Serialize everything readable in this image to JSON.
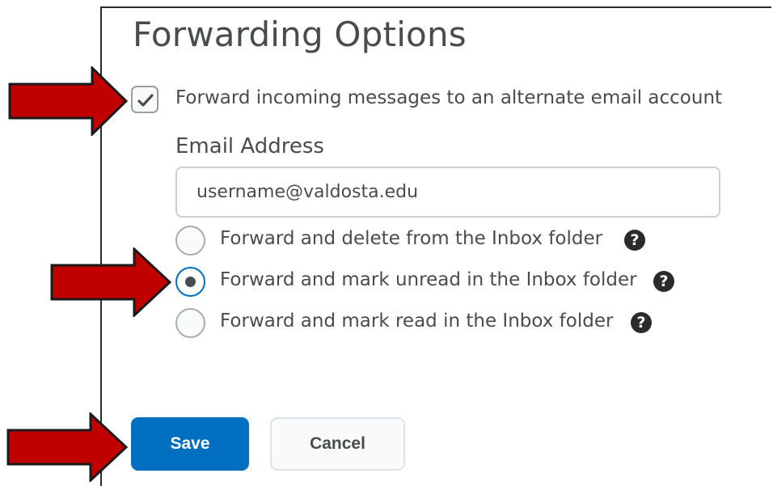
{
  "page": {
    "title": "Forwarding Options"
  },
  "forward_checkbox": {
    "checked": true,
    "label": "Forward incoming messages to an alternate email account"
  },
  "email": {
    "label": "Email Address",
    "value": "username@valdosta.edu"
  },
  "options": [
    {
      "label": "Forward and delete from the Inbox folder",
      "selected": false,
      "help_icon": "question-circle-icon"
    },
    {
      "label": "Forward and mark unread in the Inbox folder",
      "selected": true,
      "help_icon": "question-circle-icon"
    },
    {
      "label": "Forward and mark read in the Inbox folder",
      "selected": false,
      "help_icon": "question-circle-icon"
    }
  ],
  "help_glyph": "?",
  "buttons": {
    "save": "Save",
    "cancel": "Cancel"
  },
  "colors": {
    "primary": "#006fbf",
    "arrow": "#c00000",
    "text": "#494c4e"
  }
}
